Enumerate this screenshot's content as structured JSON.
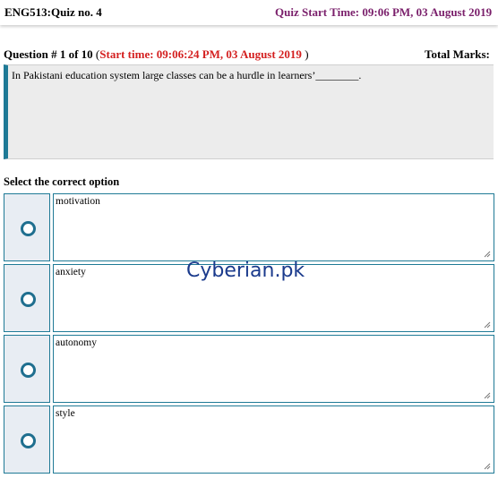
{
  "header": {
    "course_title": "ENG513:Quiz no. 4",
    "quiz_start": "Quiz Start Time: 09:06 PM, 03 August 2019"
  },
  "question": {
    "number_label": "Question # 1 of 10",
    "open_paren": "(",
    "start_time": "Start time: 09:06:24 PM, 03 August 2019",
    "close_paren": ")",
    "total_marks_label": "Total Marks:",
    "text": "In Pakistani education system large classes can be a hurdle in learners’________."
  },
  "select_label": "Select the correct option",
  "options": [
    {
      "label": "motivation"
    },
    {
      "label": "anxiety"
    },
    {
      "label": "autonomy"
    },
    {
      "label": "style"
    }
  ],
  "watermark": "Cyberian.pk",
  "colors": {
    "accent": "#1f7a96",
    "start_time_red": "#d42020",
    "quiz_start_purple": "#7a1f6b",
    "radio_cell_bg": "#e8edf3",
    "question_bg": "#ececec"
  }
}
